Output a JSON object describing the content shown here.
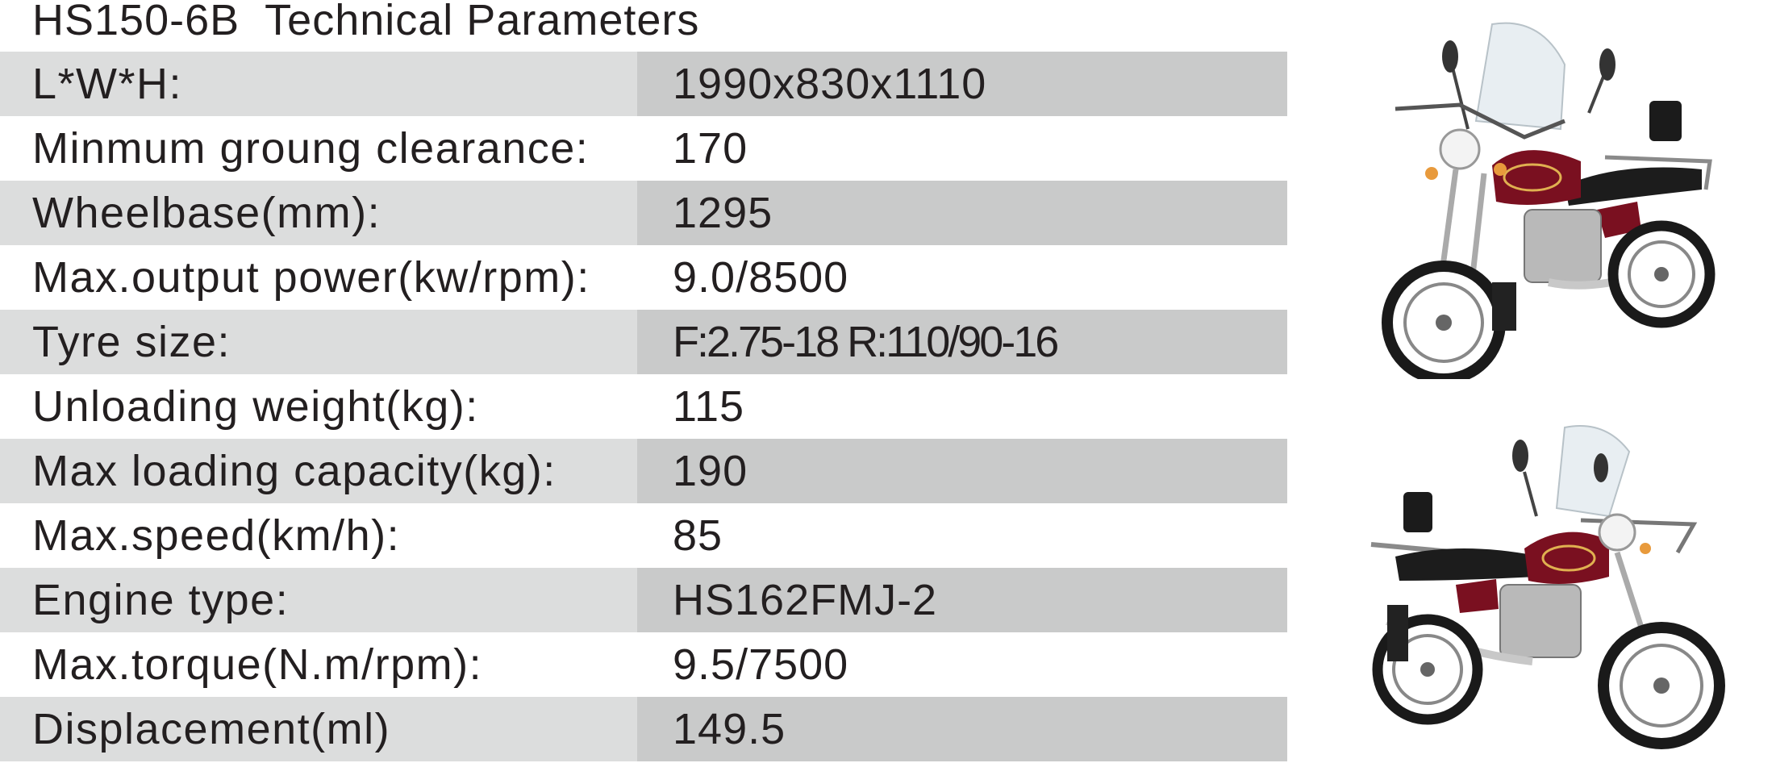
{
  "title": "HS150-6B  Technical Parameters",
  "colors": {
    "row_shade_label": "#dcdddd",
    "row_shade_value": "#c9caca",
    "text": "#231f20",
    "tank": "#7a1020"
  },
  "specs": [
    {
      "label": "L*W*H:",
      "value": "1990x830x1110"
    },
    {
      "label": "Minmum groung clearance:",
      "value": "170"
    },
    {
      "label": "Wheelbase(mm):",
      "value": "1295"
    },
    {
      "label": "Max.output power(kw/rpm):",
      "value": "9.0/8500"
    },
    {
      "label": "Tyre size:",
      "value": "F:2.75-18   R:110/90-16"
    },
    {
      "label": "Unloading weight(kg):",
      "value": "115"
    },
    {
      "label": "Max loading capacity(kg):",
      "value": "190"
    },
    {
      "label": "Max.speed(km/h):",
      "value": "85"
    },
    {
      "label": "Engine type:",
      "value": "HS162FMJ-2"
    },
    {
      "label": "Max.torque(N.m/rpm):",
      "value": "9.5/7500"
    },
    {
      "label": "Displacement(ml)",
      "value": "149.5"
    }
  ],
  "photos": [
    {
      "icon": "motorcycle-front-three-quarter-icon"
    },
    {
      "icon": "motorcycle-side-view-icon"
    }
  ]
}
